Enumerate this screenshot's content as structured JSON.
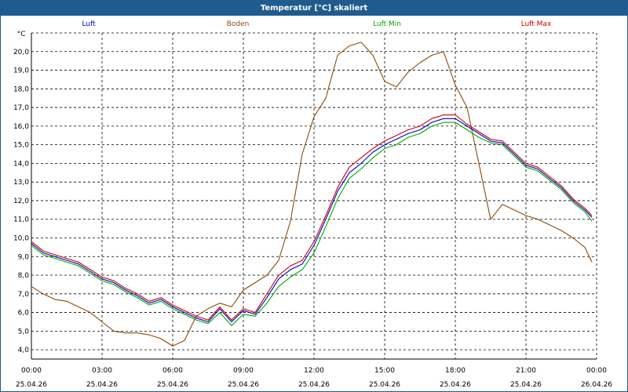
{
  "window": {
    "title": "Temperatur [°C] skaliert"
  },
  "colors": {
    "luft": "#0000cc",
    "boden": "#8b4a0d",
    "luft_min": "#00aa00",
    "luft_max": "#cc0000",
    "grid": "#000000",
    "titlebar": "#1f5b8f"
  },
  "chart_data": {
    "type": "line",
    "title": "Temperatur [°C] skaliert",
    "ylabel": "°C",
    "xlabel": "",
    "ylim": [
      3.5,
      21.0
    ],
    "xlim": [
      0,
      24
    ],
    "grid": true,
    "legend": "top",
    "y_ticks": [
      "4,0",
      "5,0",
      "6,0",
      "7,0",
      "8,0",
      "9,0",
      "10,0",
      "11,0",
      "12,0",
      "13,0",
      "14,0",
      "15,0",
      "16,0",
      "17,0",
      "18,0",
      "19,0",
      "20,0"
    ],
    "y_tick_values": [
      4,
      5,
      6,
      7,
      8,
      9,
      10,
      11,
      12,
      13,
      14,
      15,
      16,
      17,
      18,
      19,
      20
    ],
    "x_ticks": [
      {
        "time": "00:00",
        "date": "25.04.26"
      },
      {
        "time": "03:00",
        "date": "25.04.26"
      },
      {
        "time": "06:00",
        "date": "25.04.26"
      },
      {
        "time": "09:00",
        "date": "25.04.26"
      },
      {
        "time": "12:00",
        "date": "25.04.26"
      },
      {
        "time": "15:00",
        "date": "25.04.26"
      },
      {
        "time": "18:00",
        "date": "25.04.26"
      },
      {
        "time": "21:00",
        "date": "25.04.26"
      },
      {
        "time": "00:00",
        "date": "26.04.26"
      }
    ],
    "x": [
      0,
      0.5,
      1,
      1.5,
      2,
      2.5,
      3,
      3.5,
      4,
      4.5,
      5,
      5.5,
      6,
      6.5,
      7,
      7.5,
      8,
      8.5,
      9,
      9.5,
      10,
      10.5,
      11,
      11.5,
      12,
      12.5,
      13,
      13.5,
      14,
      14.5,
      15,
      15.5,
      16,
      16.5,
      17,
      17.5,
      18,
      18.5,
      19,
      19.5,
      20,
      20.5,
      21,
      21.5,
      22,
      22.5,
      23,
      23.5,
      23.8
    ],
    "series": [
      {
        "name": "Luft",
        "color": "#0000cc",
        "values": [
          9.7,
          9.2,
          9.0,
          8.8,
          8.6,
          8.2,
          7.8,
          7.6,
          7.2,
          6.9,
          6.5,
          6.7,
          6.3,
          6.0,
          5.7,
          5.5,
          6.2,
          5.5,
          6.1,
          5.9,
          6.8,
          7.8,
          8.3,
          8.6,
          9.6,
          11.0,
          12.5,
          13.5,
          14.0,
          14.6,
          15.0,
          15.3,
          15.6,
          15.8,
          16.2,
          16.4,
          16.4,
          16.0,
          15.6,
          15.2,
          15.1,
          14.5,
          13.9,
          13.7,
          13.2,
          12.7,
          12.0,
          11.5,
          11.1
        ]
      },
      {
        "name": "Boden",
        "color": "#8b4a0d",
        "values": [
          7.4,
          7.0,
          6.7,
          6.6,
          6.3,
          6.0,
          5.5,
          5.0,
          4.9,
          4.9,
          4.8,
          4.6,
          4.2,
          4.5,
          5.8,
          6.2,
          6.5,
          6.3,
          7.2,
          7.6,
          8.0,
          8.8,
          10.9,
          14.5,
          16.5,
          17.5,
          19.8,
          20.3,
          20.5,
          19.8,
          18.4,
          18.1,
          18.9,
          19.4,
          19.8,
          20.0,
          18.2,
          17.0,
          14.0,
          11.0,
          11.8,
          11.5,
          11.2,
          11.0,
          10.7,
          10.4,
          10.0,
          9.5,
          8.7
        ]
      },
      {
        "name": "Luft Min",
        "color": "#00aa00",
        "values": [
          9.6,
          9.1,
          8.9,
          8.7,
          8.5,
          8.1,
          7.7,
          7.5,
          7.1,
          6.8,
          6.4,
          6.6,
          6.2,
          5.9,
          5.6,
          5.4,
          6.0,
          5.3,
          5.9,
          5.8,
          6.5,
          7.4,
          7.9,
          8.3,
          9.2,
          10.6,
          12.1,
          13.2,
          13.7,
          14.3,
          14.8,
          15.0,
          15.4,
          15.6,
          16.0,
          16.2,
          16.2,
          15.8,
          15.4,
          15.1,
          15.0,
          14.4,
          13.8,
          13.6,
          13.1,
          12.6,
          11.9,
          11.4,
          10.9
        ]
      },
      {
        "name": "Luft Max",
        "color": "#cc0000",
        "values": [
          9.8,
          9.3,
          9.1,
          8.9,
          8.7,
          8.3,
          7.9,
          7.7,
          7.3,
          7.0,
          6.6,
          6.8,
          6.4,
          6.1,
          5.8,
          5.6,
          6.3,
          5.6,
          6.2,
          6.0,
          7.0,
          8.0,
          8.5,
          8.8,
          9.8,
          11.2,
          12.7,
          13.8,
          14.3,
          14.8,
          15.2,
          15.5,
          15.8,
          16.0,
          16.4,
          16.6,
          16.6,
          16.1,
          15.7,
          15.3,
          15.2,
          14.6,
          14.0,
          13.8,
          13.3,
          12.8,
          12.1,
          11.6,
          11.2
        ]
      }
    ]
  }
}
